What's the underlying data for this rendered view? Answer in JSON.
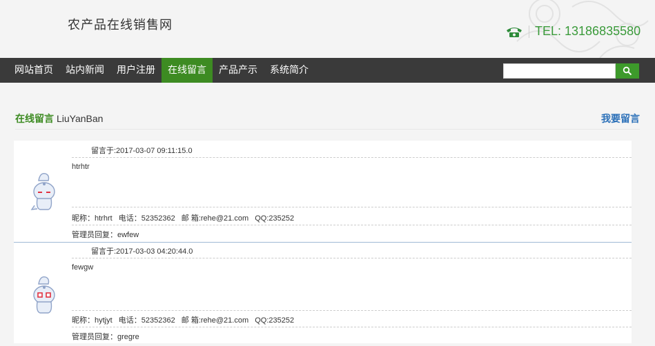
{
  "header": {
    "site_title": "农产品在线销售网",
    "tel": "TEL: 13186835580"
  },
  "nav": {
    "items": [
      {
        "label": "网站首页"
      },
      {
        "label": "站内新闻"
      },
      {
        "label": "用户注册"
      },
      {
        "label": "在线留言",
        "active": true
      },
      {
        "label": "产品产示"
      },
      {
        "label": "系统简介"
      }
    ],
    "search_placeholder": ""
  },
  "section": {
    "title_cn": "在线留言",
    "title_en": "LiuYanBan",
    "leave_message": "我要留言"
  },
  "messages": [
    {
      "time": "留言于:2017-03-07 09:11:15.0",
      "content": "htrhtr",
      "nickname": "昵称：htrhrt",
      "phone": "电话：52352362",
      "email": "邮 箱:rehe@21.com",
      "qq": "QQ:235252",
      "reply": "管理员回复：ewfew"
    },
    {
      "time": "留言于:2017-03-03 04:20:44.0",
      "content": "fewgw",
      "nickname": "昵称：hytjyt",
      "phone": "电话：52352362",
      "email": "邮 箱:rehe@21.com",
      "qq": "QQ:235252",
      "reply": "管理员回复：gregre"
    }
  ],
  "colors": {
    "nav_bg": "#3a3a3a",
    "nav_active": "#3d8b22",
    "tel_green": "#3a9a3a",
    "link_blue": "#2a6fb8"
  }
}
